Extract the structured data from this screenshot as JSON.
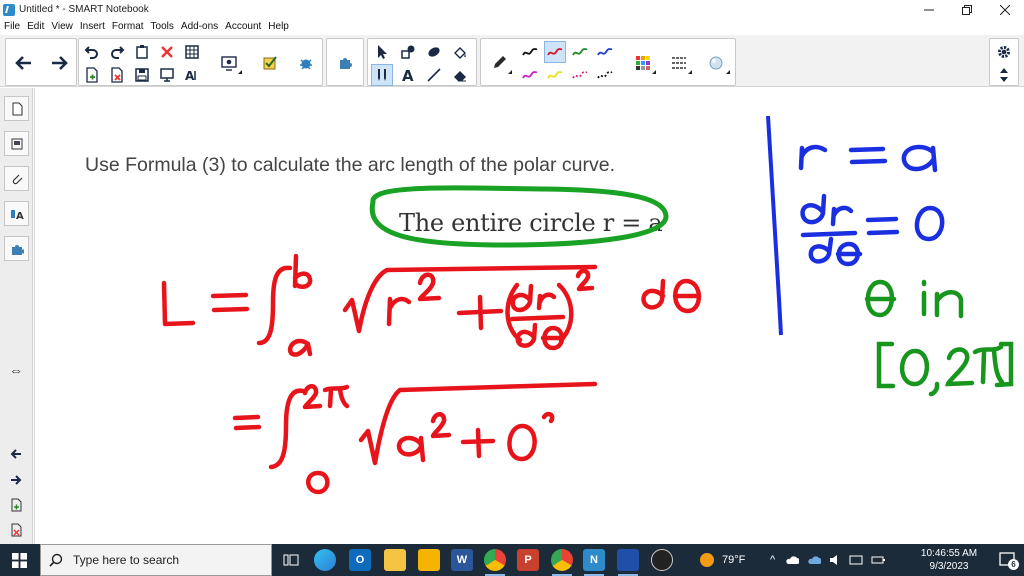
{
  "window": {
    "title": "Untitled * - SMART Notebook",
    "controls": [
      "minimize-icon",
      "restore-icon",
      "close-icon"
    ]
  },
  "menu": [
    "File",
    "Edit",
    "View",
    "Insert",
    "Format",
    "Tools",
    "Add-ons",
    "Account",
    "Help"
  ],
  "toolbar": {
    "groups": [
      "navigation",
      "edit",
      "page-tools",
      "add-ons",
      "select-tools",
      "pens",
      "fill",
      "settings"
    ],
    "pen_colors": [
      "#111111",
      "#d4162c",
      "#1f8a2a",
      "#1f3fcf",
      "#cc21c8",
      "#e8e019",
      "#e02278",
      "#111111"
    ]
  },
  "canvas": {
    "problem_text": "Use Formula (3) to calculate the arc length of the polar curve.",
    "part_text": "The entire circle r = a",
    "ink_colors": {
      "red": "#e8141b",
      "blue": "#1a2fe0",
      "green": "#17951d",
      "oval": "#19a224"
    }
  },
  "taskbar": {
    "search_placeholder": "Type here to search",
    "weather": "79°F",
    "time": "10:46:55 AM",
    "date": "9/3/2023",
    "notification_count": "6"
  }
}
